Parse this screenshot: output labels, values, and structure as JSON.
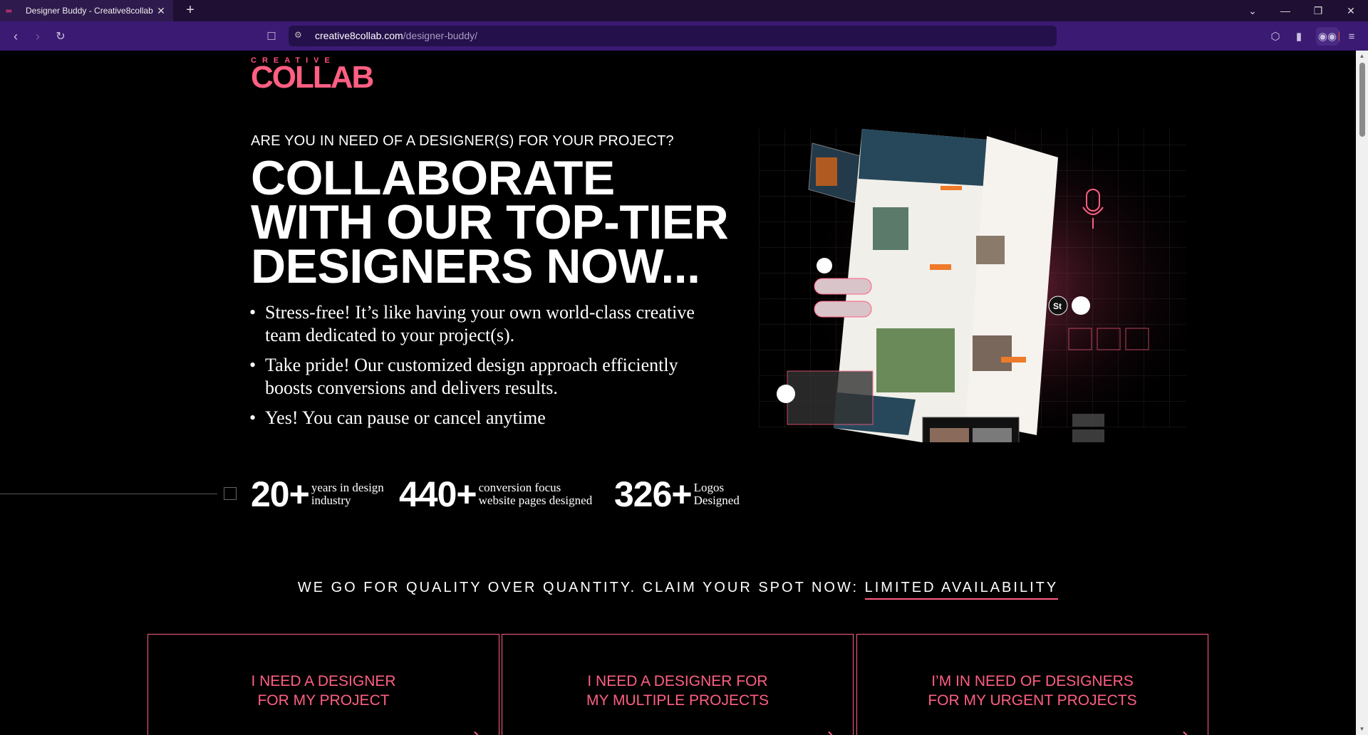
{
  "browser": {
    "tab_title": "Designer Buddy - Creative8collab",
    "url_domain": "creative8collab.com",
    "url_path": "/designer-buddy/",
    "shields_count": "2"
  },
  "logo": {
    "top": "CREATIVE",
    "main": "COLLAB"
  },
  "hero": {
    "eyebrow": "ARE YOU IN NEED OF A DESIGNER(S) FOR YOUR PROJECT?",
    "headline": [
      "COLLABORATE",
      "WITH OUR TOP-TIER",
      "DESIGNERS NOW..."
    ],
    "bullets": [
      "Stress-free! It’s like having your own world-class creative team dedicated to your project(s).",
      "Take pride! Our customized design approach efficiently boosts conversions and delivers results.",
      "Yes! You can pause or cancel anytime"
    ]
  },
  "stats": [
    {
      "number": "20+",
      "label_1": "years in design",
      "label_2": "industry"
    },
    {
      "number": "440+",
      "label_1": "conversion focus",
      "label_2": "website pages designed"
    },
    {
      "number": "326+",
      "label_1": "Logos",
      "label_2": "Designed"
    }
  ],
  "tagline": {
    "text": "WE GO FOR QUALITY OVER QUANTITY. CLAIM YOUR SPOT NOW: ",
    "highlight": "LIMITED AVAILABILITY"
  },
  "cards": [
    {
      "line_1": "I NEED A DESIGNER",
      "line_2": "FOR MY PROJECT"
    },
    {
      "line_1": "I NEED A DESIGNER FOR",
      "line_2": "MY MULTIPLE PROJECTS"
    },
    {
      "line_1": "I’M IN NEED OF DESIGNERS",
      "line_2": "FOR MY URGENT PROJECTS"
    }
  ],
  "colors": {
    "accent": "#ff5f82",
    "chrome_tabbar": "#1e0f33",
    "chrome_toolbar": "#3b1a73"
  }
}
